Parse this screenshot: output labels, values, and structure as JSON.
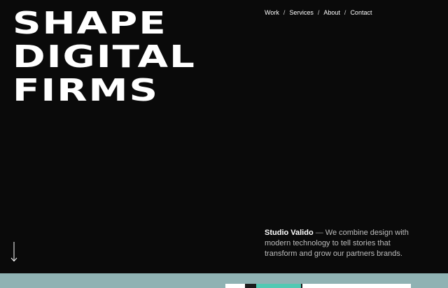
{
  "headline": {
    "lines": [
      "SHAPE",
      "DIGITAL",
      "FIRMS"
    ]
  },
  "nav": {
    "items": [
      "Work",
      "Services",
      "About",
      "Contact"
    ],
    "separator": "/"
  },
  "intro": {
    "brand": "Studio Valido",
    "dash": "—",
    "text": "We combine design with modern technology to tell stories that transform and grow our partners brands."
  },
  "icons": {
    "scroll": "arrow-down-icon"
  },
  "colors": {
    "background": "#0a0a0a",
    "text": "#ffffff",
    "muted": "#bdbdbd",
    "lower_section": "#8fb2b3",
    "accent": "#52c9b3"
  }
}
